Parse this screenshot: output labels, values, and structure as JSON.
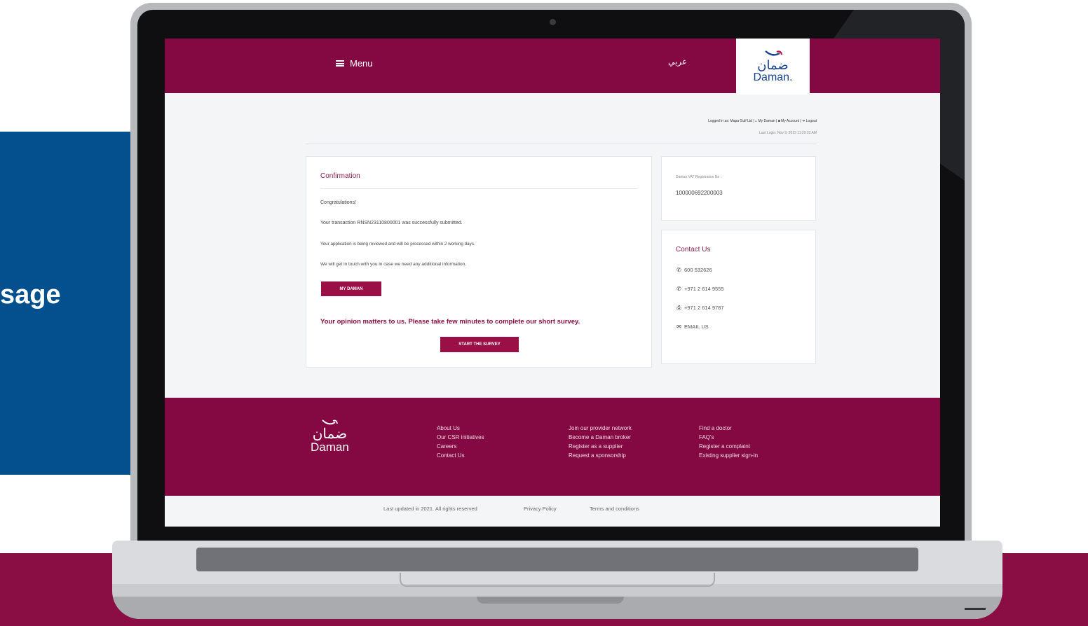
{
  "background": {
    "side_text": "sage",
    "colors": {
      "blue_panel": "#04508f",
      "band": "#8a0e43"
    }
  },
  "header": {
    "menu_label": "Menu",
    "language_label": "عربي",
    "logo": {
      "arabic": "ضمان",
      "english": "Daman."
    },
    "color": "#840842"
  },
  "userbar": {
    "logged_in_prefix": "Logged in as:",
    "company": "Mapa Gulf Ltd",
    "separator": "|",
    "my_daman": "My Daman",
    "my_account": "My Account",
    "logout": "Logout",
    "last_login": "Last Login: Nov 9, 2023 11:29:22 AM"
  },
  "confirmation": {
    "title": "Confirmation",
    "congrats": "Congratulations!",
    "transaction": "Your transaction RNSN23110800001 was successfully submitted.",
    "review": "Your application is being reviewed and will be processed within 2 working days.",
    "contact": "We will get in touch with you in case we need any additional information.",
    "my_daman_button": "MY DAMAN",
    "survey_prompt": "Your opinion matters to us. Please take few minutes to complete our short survey.",
    "survey_button": "START THE SURVEY"
  },
  "vat": {
    "label": "Daman VAT Registration No :",
    "value": "100000692200003"
  },
  "contact": {
    "title": "Contact Us",
    "phone1": "600 532626",
    "phone2": "+971 2 614 9555",
    "fax": "+971 2 614 9787",
    "email": "EMAIL US",
    "icons": [
      "phone-icon",
      "phone-icon",
      "fax-icon",
      "envelope-icon"
    ]
  },
  "footer": {
    "logo": {
      "arabic": "ضمان",
      "english": "Daman"
    },
    "col1": [
      "About Us",
      "Our CSR initiatives",
      "Careers",
      "Contact Us"
    ],
    "col2": [
      "Join our provider network",
      "Become a Daman broker",
      "Register as a supplier",
      "Request a sponsorship"
    ],
    "col3": [
      "Find a doctor",
      "FAQ's",
      "Register a complaint",
      "Existing supplier sign-in"
    ]
  },
  "subfooter": {
    "copyright": "Last updated in 2021. All rights reserved",
    "privacy": "Privacy Policy",
    "terms": "Terms and conditions"
  }
}
